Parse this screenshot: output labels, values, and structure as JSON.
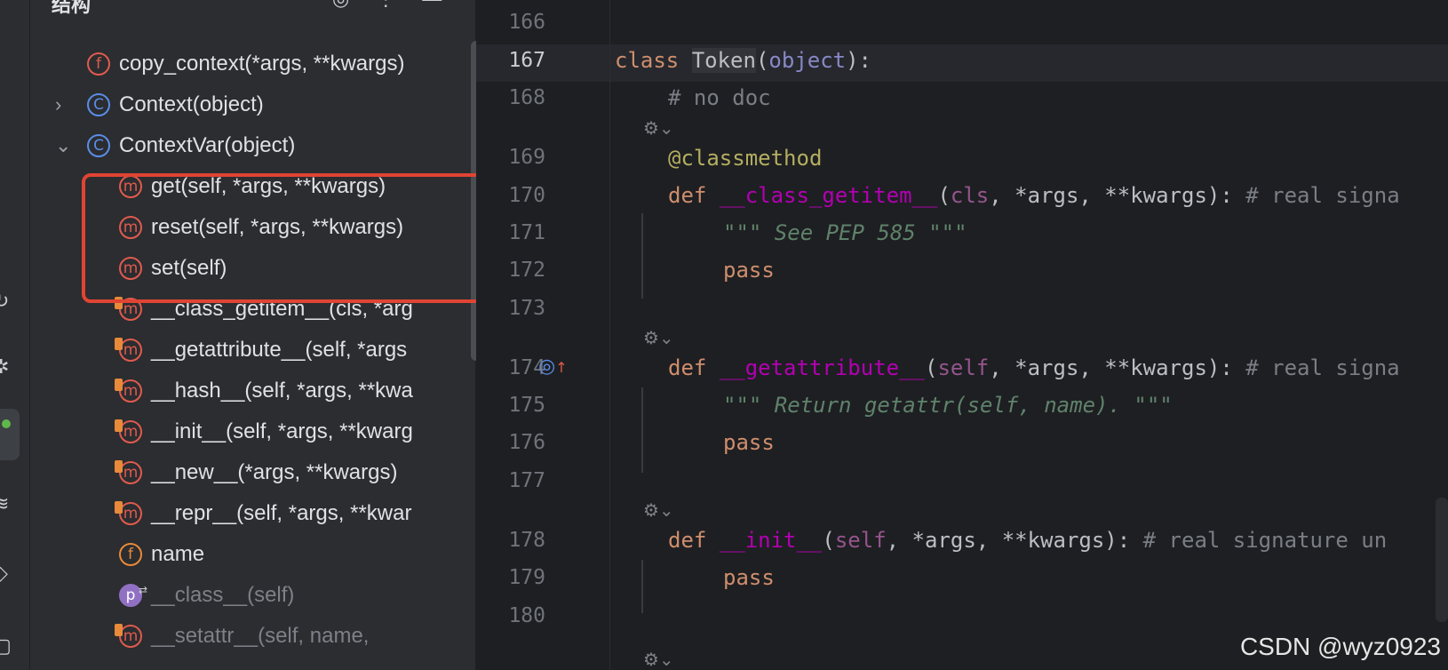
{
  "structure_panel": {
    "title": "结构",
    "items": [
      {
        "icon": "f",
        "label": "copy_context(*args, **kwargs)"
      },
      {
        "icon": "C",
        "label": "Context(object)",
        "expander": "›"
      },
      {
        "icon": "C",
        "label": "ContextVar(object)",
        "expander": "⌄"
      },
      {
        "icon": "m",
        "label": "get(self, *args, **kwargs)"
      },
      {
        "icon": "m",
        "label": "reset(self, *args, **kwargs)"
      },
      {
        "icon": "m",
        "label": "set(self)"
      },
      {
        "icon": "m",
        "label": "__class_getitem__(cls, *arg"
      },
      {
        "icon": "m",
        "label": "__getattribute__(self, *args"
      },
      {
        "icon": "m",
        "label": "__hash__(self, *args, **kwa"
      },
      {
        "icon": "m",
        "label": "__init__(self, *args, **kwarg"
      },
      {
        "icon": "m",
        "label": "__new__(*args, **kwargs)"
      },
      {
        "icon": "m",
        "label": "__repr__(self, *args, **kwar"
      },
      {
        "icon": "f",
        "label": "name"
      },
      {
        "icon": "p",
        "label": "__class__(self)"
      },
      {
        "icon": "m",
        "label": "__setattr__(self, name,"
      }
    ]
  },
  "editor": {
    "line_numbers": [
      "166",
      "167",
      "168",
      "169",
      "170",
      "171",
      "172",
      "173",
      "174",
      "175",
      "176",
      "177",
      "178",
      "179",
      "180"
    ],
    "code": {
      "l167_kw": "class",
      "l167_name": "Token",
      "l167_open": "(",
      "l167_base": "object",
      "l167_close": "):",
      "l168": "# no doc",
      "l169": "@classmethod",
      "l170_kw": "def",
      "l170_name": "__class_getitem__",
      "l170_open": "(",
      "l170_p1": "cls",
      "l170_rest": ", *args, **kwargs): ",
      "l170_cmt": "# real signa",
      "l171": "\"\"\" See PEP 585 \"\"\"",
      "l172": "pass",
      "l174_kw": "def",
      "l174_name": "__getattribute__",
      "l174_open": "(",
      "l174_p1": "self",
      "l174_rest": ", *args, **kwargs): ",
      "l174_cmt": "# real signa",
      "l175": "\"\"\" Return getattr(self, name). \"\"\"",
      "l176": "pass",
      "l178_kw": "def",
      "l178_name": "__init__",
      "l178_open": "(",
      "l178_p1": "self",
      "l178_rest": ", *args, **kwargs): ",
      "l178_cmt": "# real signature un",
      "l179": "pass"
    }
  },
  "watermark": "CSDN @wyz0923"
}
